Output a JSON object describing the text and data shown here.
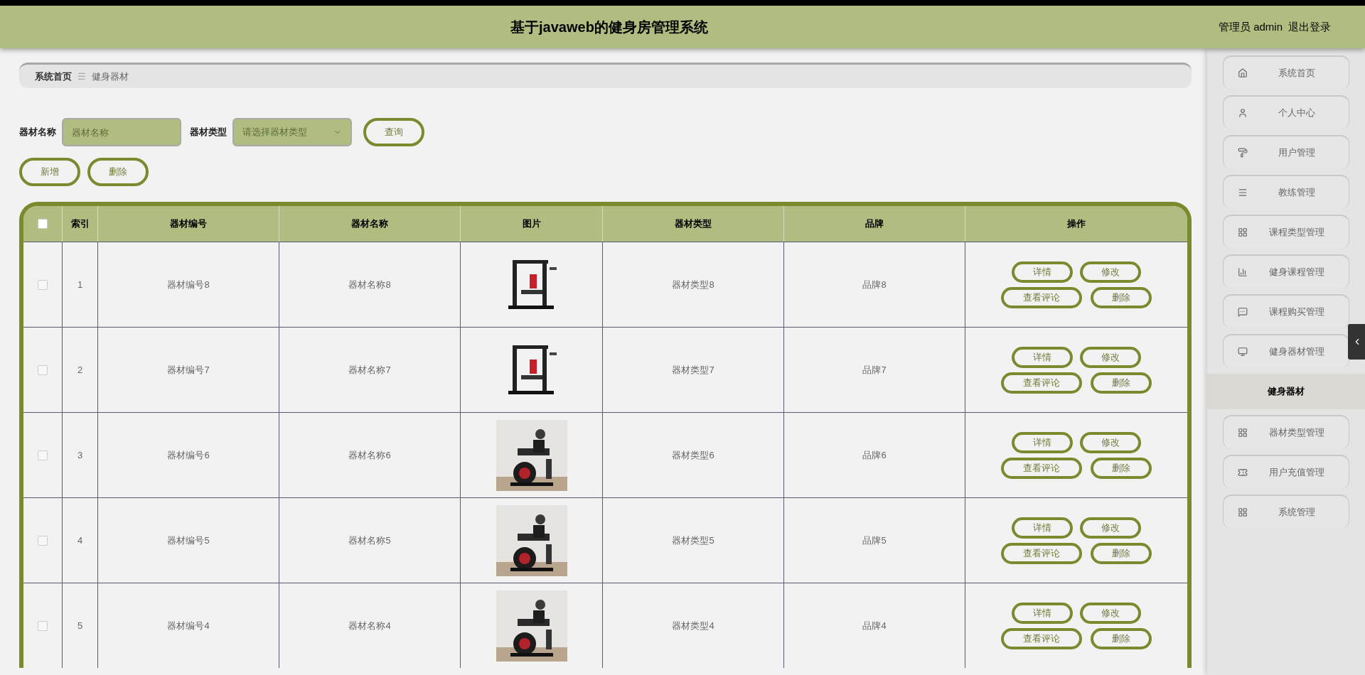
{
  "header": {
    "title": "基于javaweb的健身房管理系统",
    "user": "管理员 admin",
    "logout": "退出登录"
  },
  "breadcrumb": [
    "系统首页",
    "健身器材"
  ],
  "breadcrumb_separator": "☰",
  "search": {
    "fields": [
      {
        "label": "器材名称",
        "kind": "input",
        "placeholder": "器材名称"
      },
      {
        "label": "器材类型",
        "kind": "select",
        "placeholder": "请选择器材类型"
      }
    ],
    "button": "查询"
  },
  "actions": [
    "新增",
    "删除"
  ],
  "table": {
    "select_all_checked": false,
    "columns": [
      "索引",
      "器材编号",
      "器材名称",
      "图片",
      "器材类型",
      "品牌",
      "操作"
    ],
    "rows": [
      {
        "checked": false,
        "index": "1",
        "code": "器材编号8",
        "name": "器材名称8",
        "type": "器材类型8",
        "brand": "品牌8",
        "picture": {
          "kind": "picture"
        },
        "buttons": [
          "详情",
          "修改",
          "查看评论",
          "删除"
        ]
      },
      {
        "checked": false,
        "index": "2",
        "code": "器材编号7",
        "name": "器材名称7",
        "type": "器材类型7",
        "brand": "品牌7",
        "picture": {
          "kind": "picture"
        },
        "buttons": [
          "详情",
          "修改",
          "查看评论",
          "删除"
        ]
      },
      {
        "checked": false,
        "index": "3",
        "code": "器材编号6",
        "name": "器材名称6",
        "type": "器材类型6",
        "brand": "品牌6",
        "picture": {
          "kind": "picture"
        },
        "buttons": [
          "详情",
          "修改",
          "查看评论",
          "删除"
        ]
      },
      {
        "checked": false,
        "index": "4",
        "code": "器材编号5",
        "name": "器材名称5",
        "type": "器材类型5",
        "brand": "品牌5",
        "picture": {
          "kind": "picture"
        },
        "buttons": [
          "详情",
          "修改",
          "查看评论",
          "删除"
        ]
      },
      {
        "checked": false,
        "index": "5",
        "code": "器材编号4",
        "name": "器材名称4",
        "type": "器材类型4",
        "brand": "品牌4",
        "picture": {
          "kind": "picture"
        },
        "buttons": [
          "详情",
          "修改",
          "查看评论",
          "删除"
        ]
      }
    ]
  },
  "sidebar": {
    "items": [
      {
        "kind": "menu",
        "label": "系统首页",
        "selected": false
      },
      {
        "kind": "menu",
        "label": "个人中心",
        "selected": false
      },
      {
        "kind": "menu",
        "label": "用户管理",
        "selected": false
      },
      {
        "kind": "menu",
        "label": "教练管理",
        "selected": false
      },
      {
        "kind": "menu",
        "label": "课程类型管理",
        "selected": false
      },
      {
        "kind": "menu",
        "label": "健身课程管理",
        "selected": false
      },
      {
        "kind": "menu",
        "label": "课程购买管理",
        "selected": false
      },
      {
        "kind": "menu",
        "label": "健身器材管理",
        "selected": false
      },
      {
        "kind": "submenu",
        "label": "健身器材",
        "selected": true
      },
      {
        "kind": "menu",
        "label": "器材类型管理",
        "selected": false
      },
      {
        "kind": "menu",
        "label": "用户充值管理",
        "selected": false
      },
      {
        "kind": "menu",
        "label": "系统管理",
        "selected": false
      }
    ]
  }
}
